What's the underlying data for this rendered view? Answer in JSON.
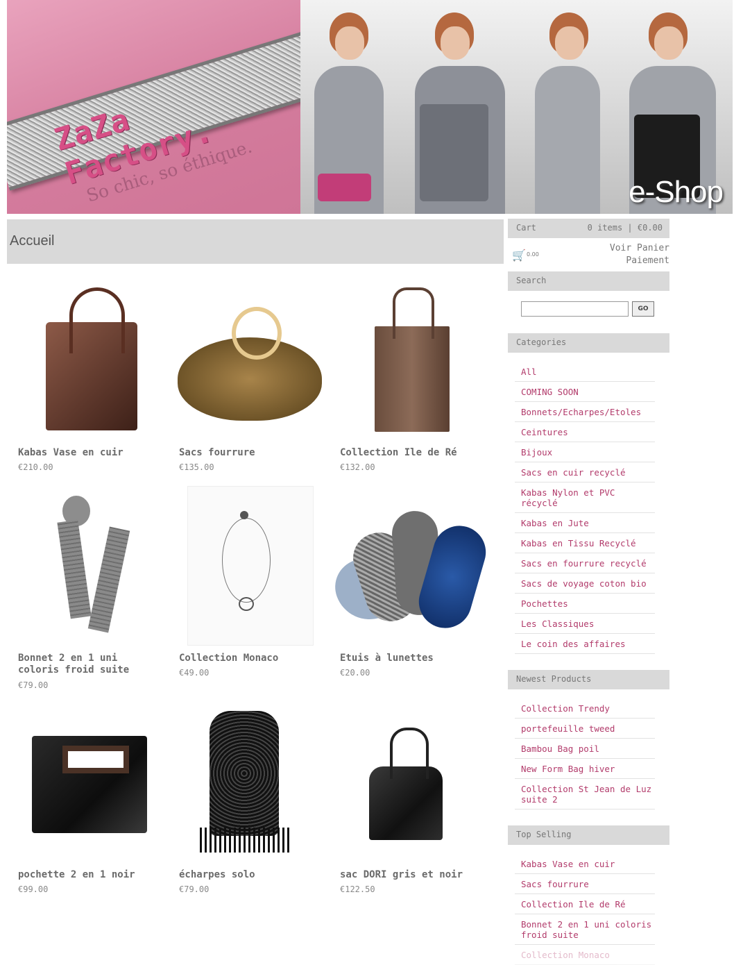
{
  "banner": {
    "logo": "ZaZa Factory.",
    "tagline": "So chic, so éthique.",
    "eshop": "e-Shop"
  },
  "page": {
    "title": "Accueil"
  },
  "products": [
    {
      "name": "Kabas Vase en cuir",
      "price": "€210.00"
    },
    {
      "name": "Sacs fourrure",
      "price": "€135.00"
    },
    {
      "name": "Collection Ile de Ré",
      "price": "€132.00"
    },
    {
      "name": "Bonnet 2 en 1 uni\ncoloris froid suite",
      "price": "€79.00"
    },
    {
      "name": "Collection Monaco",
      "price": "€49.00"
    },
    {
      "name": "Etuis à lunettes",
      "price": "€20.00"
    },
    {
      "name": "pochette 2 en 1 noir",
      "price": "€99.00"
    },
    {
      "name": "écharpes solo",
      "price": "€79.00"
    },
    {
      "name": "sac DORI gris et noir",
      "price": "€122.50"
    }
  ],
  "sidebar": {
    "cart": {
      "label": "Cart",
      "count": "0 items | €0.00",
      "icon": "cart-icon",
      "amount": "0.00",
      "view": "Voir Panier",
      "checkout": "Paiement"
    },
    "search": {
      "label": "Search",
      "value": "",
      "button": "GO"
    },
    "categories": {
      "label": "Categories",
      "items": [
        "All",
        "COMING SOON",
        "Bonnets/Echarpes/Etoles",
        "Ceintures",
        "Bijoux",
        "Sacs en cuir recyclé",
        "Kabas Nylon et PVC\nrécyclé",
        "Kabas en Jute",
        "Kabas en Tissu Recyclé",
        "Sacs en fourrure recyclé",
        "Sacs de voyage coton bio",
        "Pochettes",
        "Les Classiques",
        "Le coin des affaires"
      ]
    },
    "newest": {
      "label": "Newest Products",
      "items": [
        "Collection Trendy",
        "portefeuille tweed",
        "Bambou Bag poil",
        "New Form Bag hiver",
        "Collection St Jean de Luz\nsuite 2"
      ]
    },
    "top": {
      "label": "Top Selling",
      "items": [
        "Kabas Vase en cuir",
        "Sacs fourrure",
        "Collection Ile de Ré",
        "Bonnet 2 en 1 uni coloris\nfroid suite",
        "Collection Monaco"
      ]
    }
  },
  "colors": {
    "accent": "#b23b6b",
    "banner_pink": "#d47c9d",
    "panel_gray": "#d9d9d9"
  }
}
